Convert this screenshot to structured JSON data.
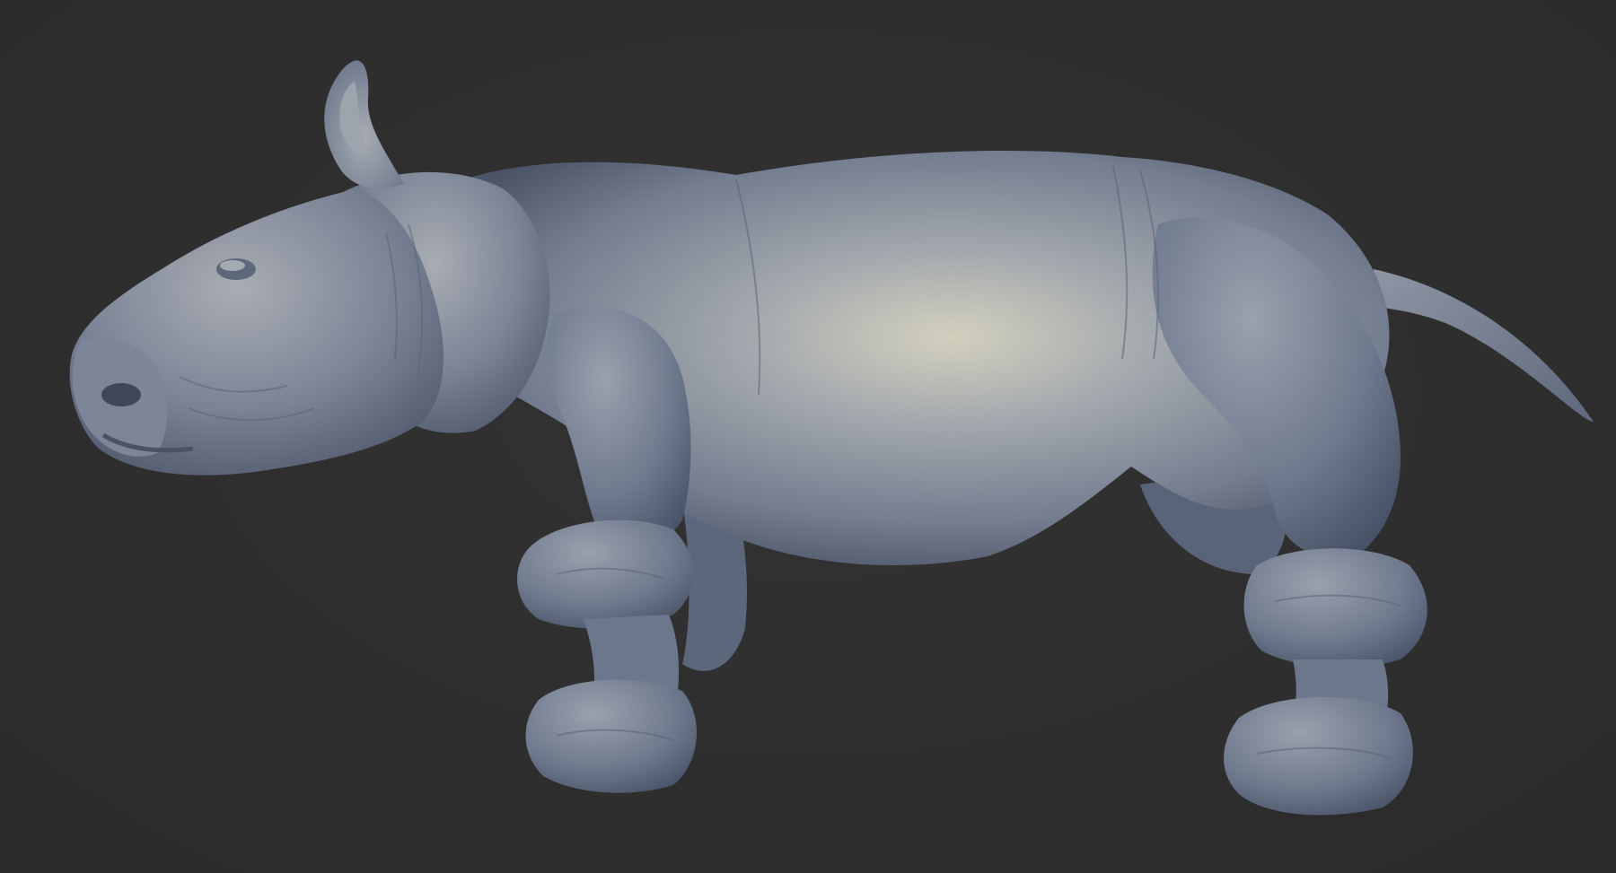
{
  "scene": {
    "background_color": "#2f2f2f",
    "subject": "rhino-calf-sculpt",
    "material_base_color": "#8a95a8",
    "material_highlight_color": "#d8d6c4",
    "material_shadow_color": "#4a5466"
  }
}
